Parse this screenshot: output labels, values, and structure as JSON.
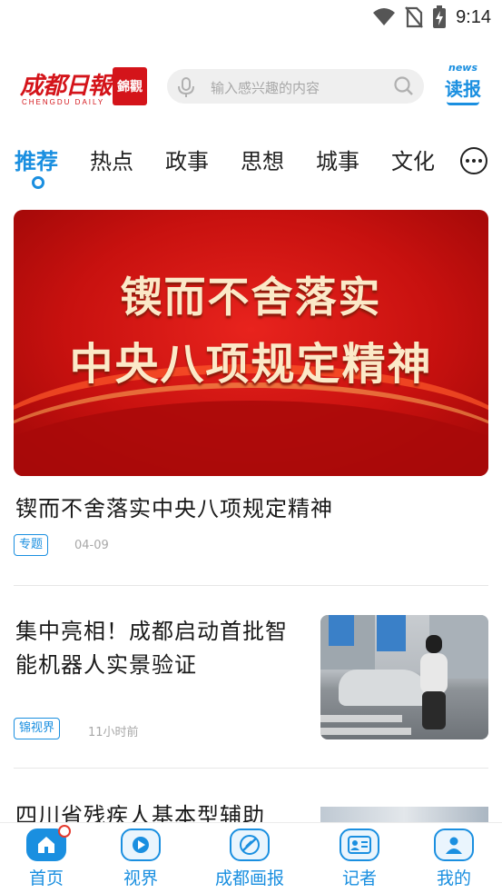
{
  "status_bar": {
    "time": "9:14"
  },
  "header": {
    "logo_main": "成都日報",
    "logo_sub": "CHENGDU DAILY",
    "logo_badge": "錦觀",
    "search_placeholder": "输入感兴趣的内容",
    "dubao_small": "news",
    "dubao_label": "读报"
  },
  "tabs": [
    {
      "label": "推荐",
      "active": true
    },
    {
      "label": "热点"
    },
    {
      "label": "政事"
    },
    {
      "label": "思想"
    },
    {
      "label": "城事"
    },
    {
      "label": "文化"
    }
  ],
  "banner": {
    "line1": "锲而不舍落实",
    "line2": "中央八项规定精神"
  },
  "articles": [
    {
      "title": "锲而不舍落实中央八项规定精神",
      "tag": "专题",
      "time": "04-09"
    },
    {
      "title": "集中亮相！成都启动首批智能机器人实景验证",
      "tag": "锦视界",
      "time": "11小时前"
    },
    {
      "title": "四川省残疾人基本型辅助"
    }
  ],
  "bottom_nav": [
    {
      "label": "首页",
      "icon": "home-icon"
    },
    {
      "label": "视界",
      "icon": "play-icon"
    },
    {
      "label": "成都画报",
      "icon": "brush-icon"
    },
    {
      "label": "记者",
      "icon": "reporter-card-icon"
    },
    {
      "label": "我的",
      "icon": "user-icon"
    }
  ],
  "colors": {
    "accent": "#1a8fe0",
    "brand_red": "#d4141a"
  }
}
